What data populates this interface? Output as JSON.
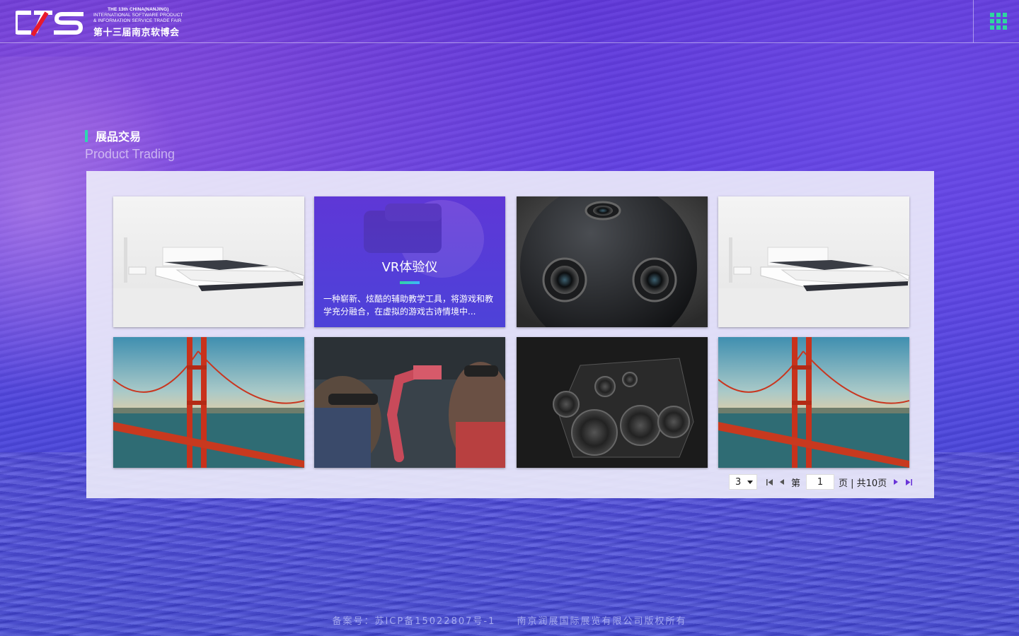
{
  "header": {
    "logo_mark": "CIS",
    "logo_en_line1": "THE 13th CHINA(NANJING)",
    "logo_en_line2": "INTERNATIONAL SOFTWARE PRODUCT",
    "logo_en_line3": "& INFORMATION SERVICE TRADE FAIR",
    "logo_cn": "第十三届南京软博会",
    "menu_icon": "grid-menu-icon",
    "accent_color": "#2fd6a0"
  },
  "section": {
    "title_cn": "展品交易",
    "title_en": "Product Trading"
  },
  "products": [
    {
      "image": "bed-photo"
    },
    {
      "image": "vr-headset-photo",
      "title": "VR体验仪",
      "description": "一种崭新、炫酷的辅助教学工具，将游戏和教学充分融合，在虚拟的游戏古诗情境中..."
    },
    {
      "image": "spherical-camera-photo"
    },
    {
      "image": "bed-photo"
    },
    {
      "image": "golden-gate-bridge-photo"
    },
    {
      "image": "hololens-robot-arm-photo"
    },
    {
      "image": "speaker-exploded-photo"
    },
    {
      "image": "golden-gate-bridge-photo"
    }
  ],
  "pagination": {
    "page_size": "3",
    "label_prefix": "第",
    "current_page": "1",
    "label_suffix": "页 | 共10页"
  },
  "footer": {
    "icp": "备案号：苏ICP备15022807号-1",
    "copyright": "南京润展国际展览有限公司版权所有"
  }
}
